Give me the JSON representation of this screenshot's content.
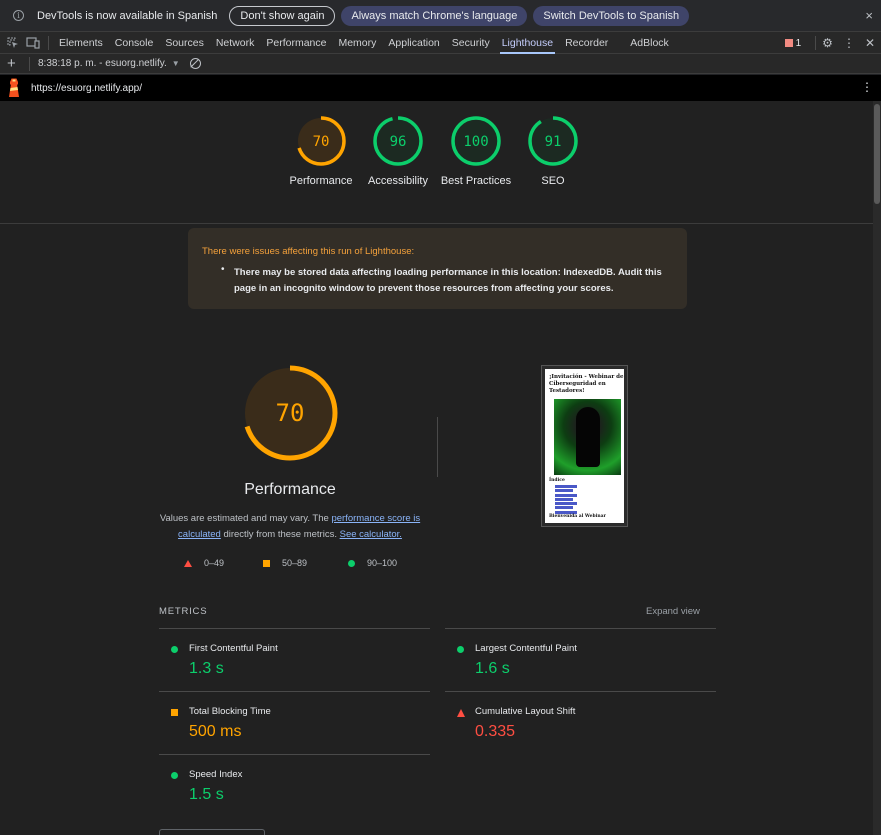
{
  "infobar": {
    "message": "DevTools is now available in Spanish",
    "dont_show": "Don't show again",
    "always_match": "Always match Chrome's language",
    "switch": "Switch DevTools to Spanish",
    "close": "×"
  },
  "tabs": [
    "Elements",
    "Console",
    "Sources",
    "Network",
    "Performance",
    "Memory",
    "Application",
    "Security",
    "Lighthouse",
    "Recorder",
    "AdBlock"
  ],
  "active_tab": "Lighthouse",
  "issues_count": "1",
  "report_toolbar": {
    "new": "+",
    "report_select": "8:38:18 p. m. - esuorg.netlify.",
    "caret": "▼"
  },
  "url": "https://esuorg.netlify.app/",
  "categories": [
    {
      "label": "Performance",
      "score": "70",
      "fraction": 0.7,
      "color": "#ffa400",
      "bg": "#3a2c1a"
    },
    {
      "label": "Accessibility",
      "score": "96",
      "fraction": 0.96,
      "color": "#0cce6b",
      "bg": "#1c2a22"
    },
    {
      "label": "Best Practices",
      "score": "100",
      "fraction": 1.0,
      "color": "#0cce6b",
      "bg": "#1c2a22"
    },
    {
      "label": "SEO",
      "score": "91",
      "fraction": 0.91,
      "color": "#0cce6b",
      "bg": "#1c2a22"
    }
  ],
  "warning": {
    "title": "There were issues affecting this run of Lighthouse:",
    "item": "There may be stored data affecting loading performance in this location: IndexedDB. Audit this page in an incognito window to prevent those resources from affecting your scores."
  },
  "perf": {
    "score": "70",
    "fraction": 0.7,
    "title": "Performance",
    "desc_1": "Values are estimated and may vary. The ",
    "desc_link_1": "performance score is calculated",
    "desc_2": " directly from these metrics. ",
    "desc_link_2": "See calculator."
  },
  "legend": {
    "fail": "0–49",
    "average": "50–89",
    "pass": "90–100"
  },
  "screenshot": {
    "title": "¡Invitación - Webinar de Ciberseguridad en Testadores!",
    "section": "Índice",
    "footer": "Bienvenida al Webinar"
  },
  "metrics_header": "METRICS",
  "expand_view": "Expand view",
  "metrics": [
    {
      "name": "First Contentful Paint",
      "value": "1.3 s",
      "rating": "pass"
    },
    {
      "name": "Largest Contentful Paint",
      "value": "1.6 s",
      "rating": "pass"
    },
    {
      "name": "Total Blocking Time",
      "value": "500 ms",
      "rating": "average"
    },
    {
      "name": "Cumulative Layout Shift",
      "value": "0.335",
      "rating": "fail"
    },
    {
      "name": "Speed Index",
      "value": "1.5 s",
      "rating": "pass"
    }
  ]
}
